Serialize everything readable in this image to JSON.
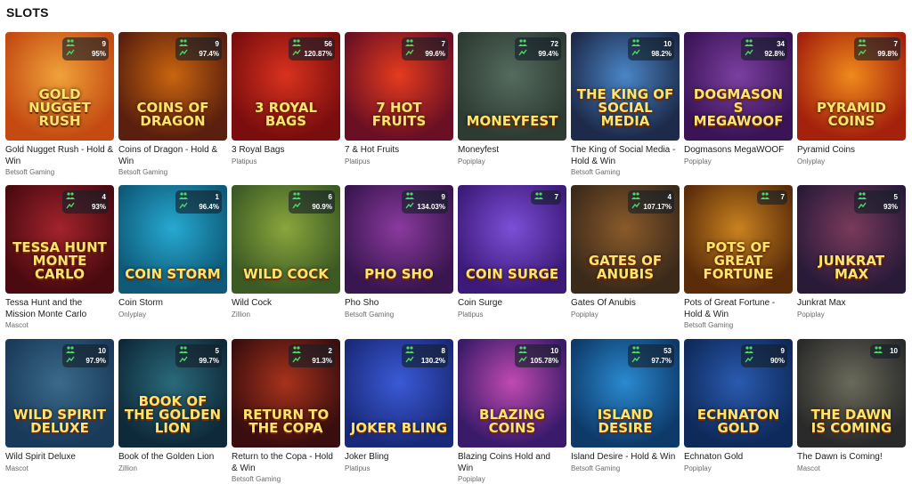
{
  "section": {
    "title": "SLOTS"
  },
  "games": [
    {
      "name": "Gold Nugget Rush - Hold & Win",
      "provider": "Betsoft Gaming",
      "players": "9",
      "rtp": "95%",
      "art": "GOLD NUGGET RUSH",
      "bg": [
        "#c44a12",
        "#f0a23a"
      ]
    },
    {
      "name": "Coins of Dragon - Hold & Win",
      "provider": "Betsoft Gaming",
      "players": "9",
      "rtp": "97.4%",
      "art": "COINS OF DRAGON",
      "bg": [
        "#5a1f0e",
        "#c9650f"
      ]
    },
    {
      "name": "3 Royal Bags",
      "provider": "Platipus",
      "players": "56",
      "rtp": "120.87%",
      "art": "3 ROYAL BAGS",
      "bg": [
        "#7a0d0d",
        "#d9321e"
      ]
    },
    {
      "name": "7 & Hot Fruits",
      "provider": "Platipus",
      "players": "7",
      "rtp": "99.6%",
      "art": "7 HOT FRUITS",
      "bg": [
        "#6a0f24",
        "#e53b1d"
      ]
    },
    {
      "name": "Moneyfest",
      "provider": "Popiplay",
      "players": "72",
      "rtp": "99.4%",
      "art": "MONEYFEST",
      "bg": [
        "#2d3b33",
        "#556b5e"
      ]
    },
    {
      "name": "The King of Social Media - Hold & Win",
      "provider": "Betsoft Gaming",
      "players": "10",
      "rtp": "98.2%",
      "art": "THE KING OF SOCIAL MEDIA",
      "bg": [
        "#1d2a4a",
        "#4a86c7"
      ]
    },
    {
      "name": "Dogmasons MegaWOOF",
      "provider": "Popiplay",
      "players": "34",
      "rtp": "92.8%",
      "art": "DOGMASONS MEGAWOOF",
      "bg": [
        "#3a1456",
        "#7b3fa0"
      ]
    },
    {
      "name": "Pyramid Coins",
      "provider": "Onlyplay",
      "players": "7",
      "rtp": "99.8%",
      "art": "PYRAMID COINS",
      "bg": [
        "#a4210c",
        "#f08a1c"
      ]
    },
    {
      "name": "Tessa Hunt and the Mission Monte Carlo",
      "provider": "Mascot",
      "players": "4",
      "rtp": "93%",
      "art": "TESSA HUNT MONTE CARLO",
      "bg": [
        "#4a0a10",
        "#a3232c"
      ]
    },
    {
      "name": "Coin Storm",
      "provider": "Onlyplay",
      "players": "1",
      "rtp": "96.4%",
      "art": "COIN STORM",
      "bg": [
        "#0e5a78",
        "#27a9d1"
      ]
    },
    {
      "name": "Wild Cock",
      "provider": "Zillion",
      "players": "6",
      "rtp": "90.9%",
      "art": "WILD COCK",
      "bg": [
        "#3c5a24",
        "#8aa63d"
      ]
    },
    {
      "name": "Pho Sho",
      "provider": "Betsoft Gaming",
      "players": "9",
      "rtp": "134.03%",
      "art": "PHO SHO",
      "bg": [
        "#3a1650",
        "#8a3a9e"
      ]
    },
    {
      "name": "Coin Surge",
      "provider": "Platipus",
      "players": "7",
      "rtp": "",
      "art": "COIN SURGE",
      "bg": [
        "#3c1a7a",
        "#7d4fd6"
      ]
    },
    {
      "name": "Gates Of Anubis",
      "provider": "Popiplay",
      "players": "4",
      "rtp": "107.17%",
      "art": "GATES OF ANUBIS",
      "bg": [
        "#3b2a1a",
        "#8a5a2a"
      ]
    },
    {
      "name": "Pots of Great Fortune - Hold & Win",
      "provider": "Betsoft Gaming",
      "players": "7",
      "rtp": "",
      "art": "POTS OF GREAT FORTUNE",
      "bg": [
        "#5a2c0a",
        "#c9821f"
      ]
    },
    {
      "name": "Junkrat Max",
      "provider": "Popiplay",
      "players": "5",
      "rtp": "93%",
      "art": "JUNKRAT MAX",
      "bg": [
        "#2a1a3a",
        "#7a3a5a"
      ]
    },
    {
      "name": "Wild Spirit Deluxe",
      "provider": "Mascot",
      "players": "10",
      "rtp": "97.9%",
      "art": "WILD SPIRIT DELUXE",
      "bg": [
        "#1a3a5a",
        "#3a6a8a"
      ]
    },
    {
      "name": "Book of the Golden Lion",
      "provider": "Zillion",
      "players": "5",
      "rtp": "99.7%",
      "art": "BOOK OF THE GOLDEN LION",
      "bg": [
        "#0e2a3a",
        "#2a6a7a"
      ]
    },
    {
      "name": "Return to the Copa - Hold & Win",
      "provider": "Betsoft Gaming",
      "players": "2",
      "rtp": "91.3%",
      "art": "RETURN TO THE COPA",
      "bg": [
        "#3a0e0e",
        "#a8321c"
      ]
    },
    {
      "name": "Joker Bling",
      "provider": "Platipus",
      "players": "8",
      "rtp": "130.2%",
      "art": "JOKER BLING",
      "bg": [
        "#1a2a7a",
        "#3a5ad6"
      ]
    },
    {
      "name": "Blazing Coins Hold and Win",
      "provider": "Popiplay",
      "players": "10",
      "rtp": "105.78%",
      "art": "BLAZING COINS",
      "bg": [
        "#3a1a6a",
        "#c04ab0"
      ]
    },
    {
      "name": "Island Desire - Hold & Win",
      "provider": "Betsoft Gaming",
      "players": "53",
      "rtp": "97.7%",
      "art": "ISLAND DESIRE",
      "bg": [
        "#0e3a6a",
        "#2a8ad0"
      ]
    },
    {
      "name": "Echnaton Gold",
      "provider": "Popiplay",
      "players": "9",
      "rtp": "90%",
      "art": "ECHNATON GOLD",
      "bg": [
        "#0e2a5a",
        "#2a5ab0"
      ]
    },
    {
      "name": "The Dawn is Coming!",
      "provider": "Mascot",
      "players": "10",
      "rtp": "",
      "art": "THE DAWN IS COMING",
      "bg": [
        "#2a2a2a",
        "#6a6a5a"
      ]
    }
  ]
}
